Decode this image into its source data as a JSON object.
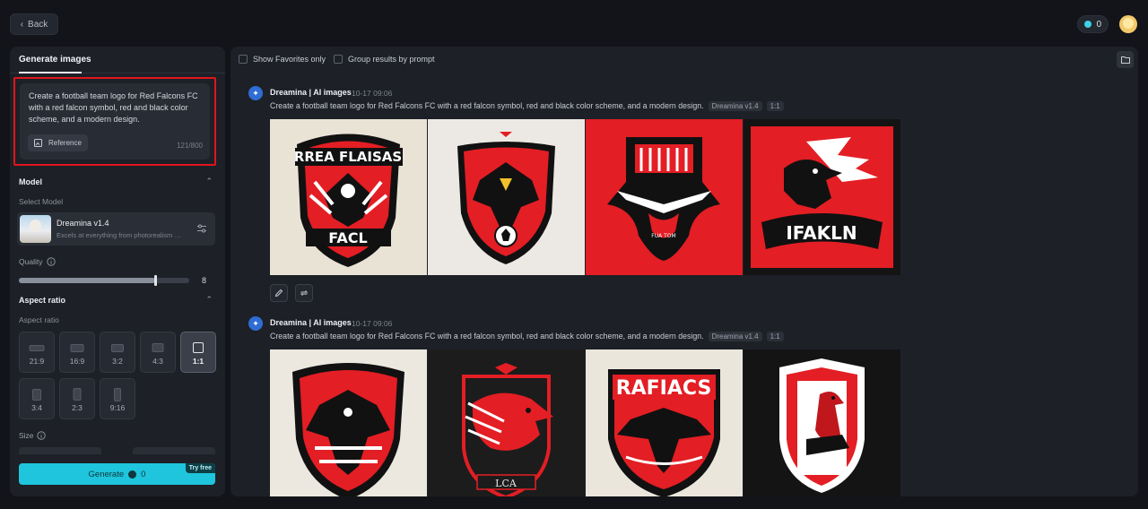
{
  "topbar": {
    "back_label": "Back",
    "credits": "0"
  },
  "left": {
    "tab_label": "Generate images",
    "prompt_text": "Create a football team logo for Red Falcons FC with a red falcon symbol, red and black color scheme, and a modern design.",
    "reference_label": "Reference",
    "char_count": "121/800",
    "model_section": "Model",
    "select_model_label": "Select Model",
    "model_name": "Dreamina v1.4",
    "model_desc": "Excels at everything from photorealism to...",
    "quality_label": "Quality",
    "quality_value": "8",
    "quality_fraction": 0.8,
    "aspect_section": "Aspect ratio",
    "aspect_label": "Aspect ratio",
    "aspect_ratios": [
      "21:9",
      "16:9",
      "3:2",
      "4:3",
      "1:1",
      "3:4",
      "2:3",
      "9:16"
    ],
    "aspect_selected": "1:1",
    "size_label": "Size",
    "generate_label": "Generate",
    "generate_cost": "0",
    "try_free": "Try free"
  },
  "right": {
    "show_favorites": "Show Favorites only",
    "group_by_prompt": "Group results by prompt",
    "groups": [
      {
        "title": "Dreamina | AI images",
        "time": "10-17   09:06",
        "prompt": "Create a football team logo for Red Falcons FC with a red falcon symbol, red and black color scheme, and a modern design.",
        "model_tag": "Dreamina v1.4",
        "ratio_tag": "1:1",
        "image_texts": [
          "RREA FLAISAS",
          "FACL",
          "",
          "FUA   TOM",
          "IFAKLN"
        ]
      },
      {
        "title": "Dreamina | AI images",
        "time": "10-17   09:06",
        "prompt": "Create a football team logo for Red Falcons FC with a red falcon symbol, red and black color scheme, and a modern design.",
        "model_tag": "Dreamina v1.4",
        "ratio_tag": "1:1",
        "image_texts": [
          "",
          "LCA",
          "RAFIACS",
          ""
        ]
      }
    ]
  },
  "colors": {
    "accent": "#1ec5dc",
    "highlight_border": "#e0161c",
    "logo_red": "#e31e24",
    "logo_black": "#111111"
  }
}
